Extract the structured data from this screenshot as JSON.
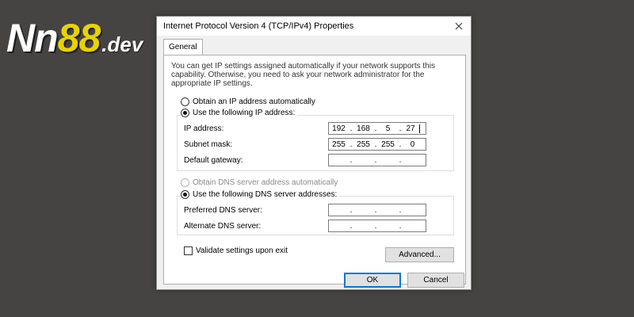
{
  "logo": {
    "part1": "Nn",
    "part2": "88",
    "part3": ".dev"
  },
  "window": {
    "title": "Internet Protocol Version 4 (TCP/IPv4) Properties"
  },
  "tabs": [
    {
      "label": "General"
    }
  ],
  "intro_text": "You can get IP settings assigned automatically if your network supports this capability. Otherwise, you need to ask your network administrator for the appropriate IP settings.",
  "ip_settings": {
    "auto_label": "Obtain an IP address automatically",
    "manual_label": "Use the following IP address:",
    "selected": "manual",
    "fields": [
      {
        "label": "IP address:",
        "octets": [
          "192",
          "168",
          "5",
          "27"
        ]
      },
      {
        "label": "Subnet mask:",
        "octets": [
          "255",
          "255",
          "255",
          "0"
        ]
      },
      {
        "label": "Default gateway:",
        "octets": [
          "",
          "",
          "",
          ""
        ]
      }
    ]
  },
  "dns_settings": {
    "auto_label": "Obtain DNS server address automatically",
    "manual_label": "Use the following DNS server addresses:",
    "selected": "manual",
    "fields": [
      {
        "label": "Preferred DNS server:",
        "octets": [
          "",
          "",
          "",
          ""
        ]
      },
      {
        "label": "Alternate DNS server:",
        "octets": [
          "",
          "",
          "",
          ""
        ]
      }
    ]
  },
  "validate": {
    "label": "Validate settings upon exit",
    "checked": false
  },
  "buttons": {
    "advanced": "Advanced...",
    "ok": "OK",
    "cancel": "Cancel"
  },
  "icons": {
    "close": "close-icon"
  }
}
